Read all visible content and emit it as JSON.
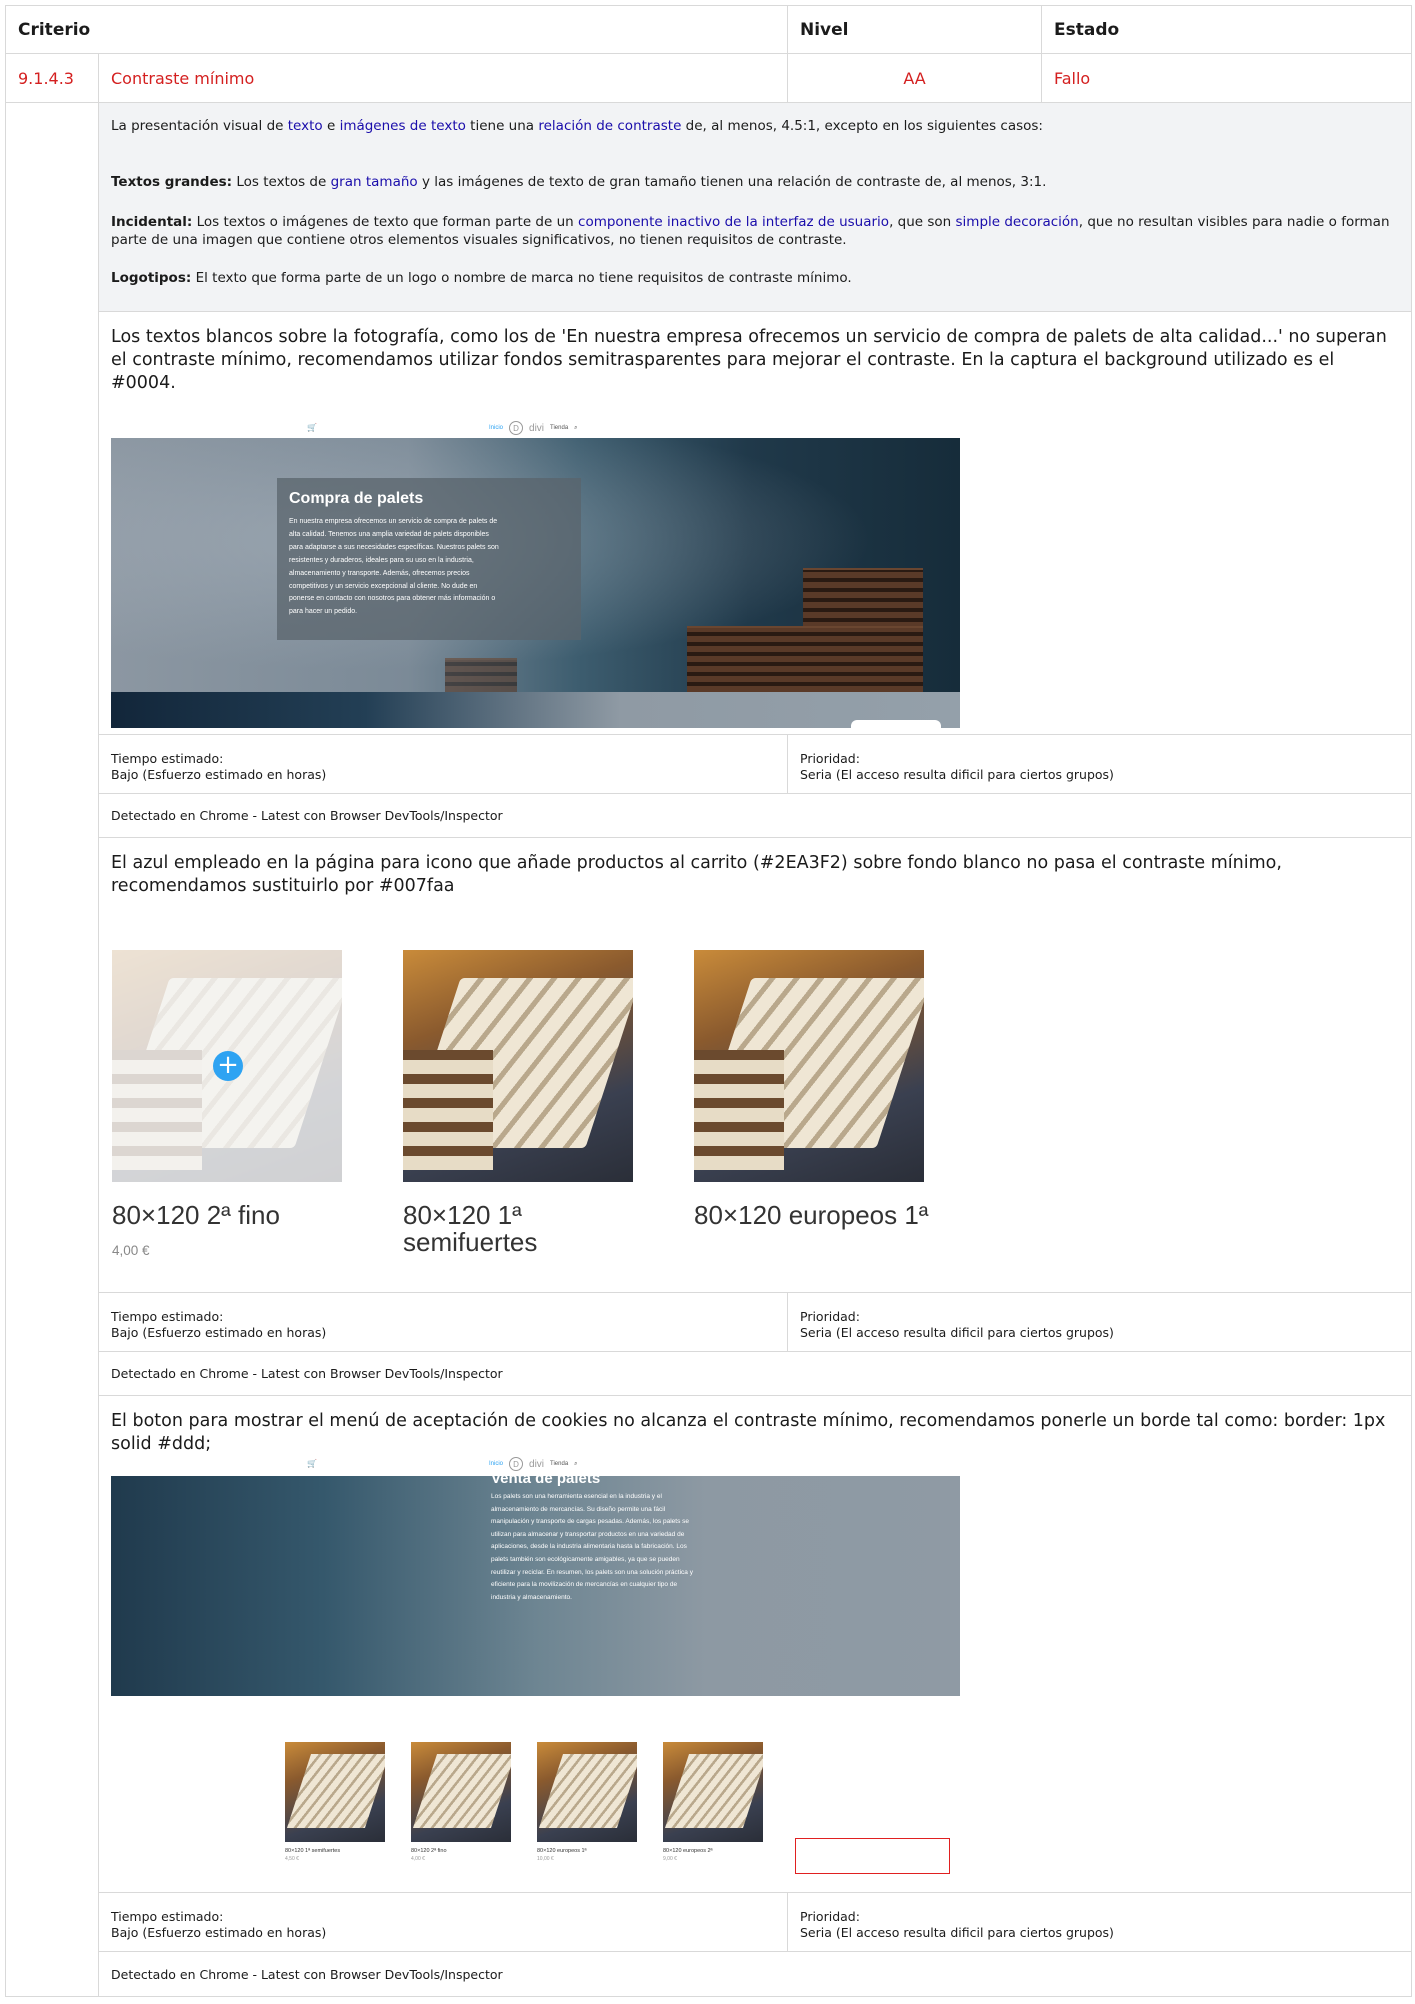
{
  "table": {
    "headers": {
      "criterio": "Criterio",
      "nivel": "Nivel",
      "estado": "Estado"
    },
    "criterion": {
      "id": "9.1.4.3",
      "name": "Contraste mínimo",
      "level": "AA",
      "status": "Fallo"
    },
    "description": {
      "intro": {
        "a": "La presentación visual de ",
        "link1": "texto",
        "b": " e ",
        "link2": "imágenes de texto",
        "c": " tiene una ",
        "link3": "relación de contraste",
        "d": " de, al menos, 4.5:1, excepto en los siguientes casos:"
      },
      "large": {
        "label": "Textos grandes:",
        "a": " Los textos de ",
        "link": "gran tamaño",
        "b": " y las imágenes de texto de gran tamaño tienen una relación de contraste de, al menos, 3:1."
      },
      "incidental": {
        "label": "Incidental:",
        "a": " Los textos o imágenes de texto que forman parte de un ",
        "link1": "componente inactivo de la interfaz de usuario",
        "b": ", que son ",
        "link2": "simple decoración",
        "c": ", que no resultan visibles para nadie o forman parte de una imagen que contiene otros elementos visuales significativos, no tienen requisitos de contraste."
      },
      "logos": {
        "label": "Logotipos:",
        "a": " El texto que forma parte de un logo o nombre de marca no tiene requisitos de contraste mínimo."
      }
    }
  },
  "issues": [
    {
      "text": "Los textos blancos sobre la fotografía, como los de 'En nuestra empresa ofrecemos un servicio de compra de palets de alta calidad...' no superan el contraste mínimo, recomendamos utilizar fondos semitrasparentes para mejorar el contraste. En la captura el background utilizado es el #0004.",
      "time_label": "Tiempo estimado:",
      "time_value": "Bajo (Esfuerzo estimado en horas)",
      "priority_label": "Prioridad:",
      "priority_value": "Seria (El acceso resulta dificil para ciertos grupos)",
      "detected": "Detectado en Chrome - Latest con Browser DevTools/Inspector"
    },
    {
      "text": "El azul empleado en la página para icono que añade productos al carrito (#2EA3F2) sobre fondo blanco no pasa el contraste mínimo, recomendamos sustituirlo por #007faa",
      "time_label": "Tiempo estimado:",
      "time_value": "Bajo (Esfuerzo estimado en horas)",
      "priority_label": "Prioridad:",
      "priority_value": "Seria (El acceso resulta dificil para ciertos grupos)",
      "detected": "Detectado en Chrome - Latest con Browser DevTools/Inspector"
    },
    {
      "text": "El boton para mostrar el menú de aceptación de cookies no alcanza el contraste mínimo, recomendamos ponerle un borde tal como: border: 1px solid #ddd;",
      "time_label": "Tiempo estimado:",
      "time_value": "Bajo (Esfuerzo estimado en horas)",
      "priority_label": "Prioridad:",
      "priority_value": "Seria (El acceso resulta dificil para ciertos grupos)",
      "detected": "Detectado en Chrome - Latest con Browser DevTools/Inspector"
    }
  ],
  "screenshot1": {
    "nav_inicio": "Inicio",
    "nav_logo": "divi",
    "nav_tienda": "Tienda",
    "box_title": "Compra de palets",
    "box_text": "En nuestra empresa ofrecemos un servicio de compra de palets de alta calidad. Tenemos una amplia variedad de palets disponibles para adaptarse a sus necesidades específicas. Nuestros palets son resistentes y duraderos, ideales para su uso en la industria, almacenamiento y transporte. Además, ofrecemos precios competitivos y un servicio excepcional al cliente. No dude en ponerse en contacto con nosotros para obtener más información o para hacer un pedido."
  },
  "screenshot2": {
    "products": [
      {
        "title": "80×120 2ª fino",
        "price": "4,00 €"
      },
      {
        "title": "80×120 1ª semifuertes",
        "price": ""
      },
      {
        "title": "80×120 europeos 1ª",
        "price": ""
      }
    ]
  },
  "screenshot3": {
    "nav_inicio": "Inicio",
    "nav_logo": "divi",
    "nav_tienda": "Tienda",
    "box_title": "Venta de palets",
    "box_text": "Los palets son una herramienta esencial en la industria y el almacenamiento de mercancías. Su diseño permite una fácil manipulación y transporte de cargas pesadas. Además, los palets se utilizan para almacenar y transportar productos en una variedad de aplicaciones, desde la industria alimentaria hasta la fabricación. Los palets también son ecológicamente amigables, ya que se pueden reutilizar y reciclar. En resumen, los palets son una solución práctica y eficiente para la movilización de mercancías en cualquier tipo de industria y almacenamiento.",
    "thumbs": [
      {
        "name": "80×120 1ª semifuertes",
        "price": "4,50 €"
      },
      {
        "name": "80×120 2ª fino",
        "price": "4,00 €"
      },
      {
        "name": "80×120 europeos 1ª",
        "price": "10,00 €"
      },
      {
        "name": "80×120 europeos 2ª",
        "price": "9,00 €"
      }
    ]
  },
  "colors": {
    "fail": "#d42020",
    "link": "#1a0dab",
    "divi_blue": "#2ea3f2"
  }
}
